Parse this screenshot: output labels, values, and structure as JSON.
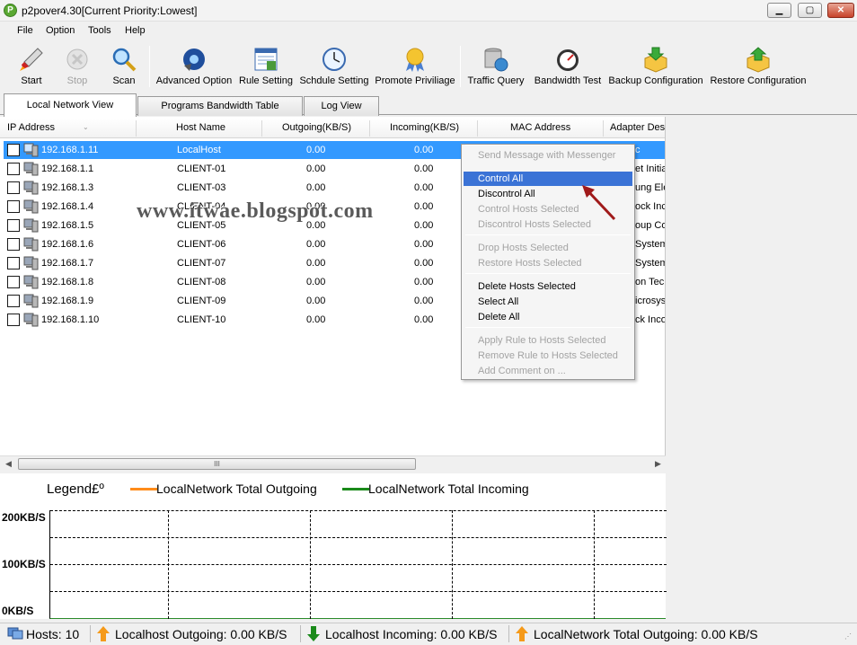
{
  "window": {
    "title": "p2pover4.30[Current Priority:Lowest]",
    "icon": "app-icon"
  },
  "menu": [
    "File",
    "Option",
    "Tools",
    "Help"
  ],
  "toolbar": [
    {
      "label": "Start",
      "icon": "start-icon",
      "disabled": false
    },
    {
      "label": "Stop",
      "icon": "stop-icon",
      "disabled": true
    },
    {
      "label": "Scan",
      "icon": "magnifier-icon",
      "disabled": false
    },
    {
      "label": "Advanced Option",
      "icon": "advanced-option-icon",
      "disabled": false
    },
    {
      "label": "Rule Setting",
      "icon": "rule-setting-icon",
      "disabled": false
    },
    {
      "label": "Schdule Setting",
      "icon": "clock-icon",
      "disabled": false
    },
    {
      "label": "Promote Priviliage",
      "icon": "medal-icon",
      "disabled": false
    },
    {
      "label": "Traffic Query",
      "icon": "database-globe-icon",
      "disabled": false
    },
    {
      "label": "Bandwidth Test",
      "icon": "speedometer-icon",
      "disabled": false
    },
    {
      "label": "Backup Configuration",
      "icon": "backup-box-icon",
      "disabled": false
    },
    {
      "label": "Restore Configuration",
      "icon": "restore-box-icon",
      "disabled": false
    }
  ],
  "tabs": [
    "Local Network View",
    "Programs Bandwidth Table",
    "Log View"
  ],
  "active_tab": 0,
  "columns": [
    "IP Address",
    "Host Name",
    "Outgoing(KB/S)",
    "Incoming(KB/S)",
    "MAC Address",
    "Adapter Desc"
  ],
  "rows": [
    {
      "ip": "192.168.1.11",
      "host": "LocalHost",
      "out": "0.00",
      "in": "0.00",
      "adapter": "c",
      "selected": true
    },
    {
      "ip": "192.168.1.1",
      "host": "CLIENT-01",
      "out": "0.00",
      "in": "0.00",
      "adapter": "et Initiat",
      "selected": false
    },
    {
      "ip": "192.168.1.3",
      "host": "CLIENT-03",
      "out": "0.00",
      "in": "0.00",
      "adapter": "ung Ele",
      "selected": false
    },
    {
      "ip": "192.168.1.4",
      "host": "CLIENT-04",
      "out": "0.00",
      "in": "0.00",
      "adapter": "ock Inco",
      "selected": false
    },
    {
      "ip": "192.168.1.5",
      "host": "CLIENT-05",
      "out": "0.00",
      "in": "0.00",
      "adapter": "oup Co",
      "selected": false
    },
    {
      "ip": "192.168.1.6",
      "host": "CLIENT-06",
      "out": "0.00",
      "in": "0.00",
      "adapter": "System",
      "selected": false
    },
    {
      "ip": "192.168.1.7",
      "host": "CLIENT-07",
      "out": "0.00",
      "in": "0.00",
      "adapter": "System",
      "selected": false
    },
    {
      "ip": "192.168.1.8",
      "host": "CLIENT-08",
      "out": "0.00",
      "in": "0.00",
      "adapter": "on Tec",
      "selected": false
    },
    {
      "ip": "192.168.1.9",
      "host": "CLIENT-09",
      "out": "0.00",
      "in": "0.00",
      "adapter": "icrosys",
      "selected": false
    },
    {
      "ip": "192.168.1.10",
      "host": "CLIENT-10",
      "out": "0.00",
      "in": "0.00",
      "adapter": "ck Inco",
      "selected": false
    }
  ],
  "context_menu": [
    {
      "label": "Send Message with Messenger",
      "disabled": true
    },
    {
      "sep": true
    },
    {
      "label": "Control All",
      "disabled": false,
      "highlighted": true
    },
    {
      "label": "Discontrol All",
      "disabled": false
    },
    {
      "label": "Control Hosts Selected",
      "disabled": true
    },
    {
      "label": "Discontrol Hosts Selected",
      "disabled": true
    },
    {
      "sep": true
    },
    {
      "label": "Drop Hosts Selected",
      "disabled": true
    },
    {
      "label": "Restore Hosts Selected",
      "disabled": true
    },
    {
      "sep": true
    },
    {
      "label": "Delete Hosts Selected",
      "disabled": false
    },
    {
      "label": "Select All",
      "disabled": false
    },
    {
      "label": "Delete All",
      "disabled": false
    },
    {
      "sep": true
    },
    {
      "label": "Apply Rule to Hosts Selected",
      "disabled": true
    },
    {
      "label": "Remove Rule to Hosts Selected",
      "disabled": true
    },
    {
      "label": "Add Comment on ...",
      "disabled": true
    }
  ],
  "watermark": "www.itwae.blogspot.com",
  "scrollbar_grip": "III",
  "graph": {
    "legend_title": "Legend£º",
    "series": [
      {
        "name": "LocalNetwork Total Outgoing",
        "color": "#ff8c1a"
      },
      {
        "name": "LocalNetwork Total Incoming",
        "color": "#1a8a1a"
      }
    ],
    "y_labels": [
      "200KB/S",
      "100KB/S",
      "0KB/S"
    ]
  },
  "status": {
    "hosts": "Hosts: 10",
    "localhost_out": "Localhost Outgoing: 0.00 KB/S",
    "localhost_in": "Localhost Incoming: 0.00 KB/S",
    "network_out": "LocalNetwork Total Outgoing: 0.00 KB/S"
  }
}
